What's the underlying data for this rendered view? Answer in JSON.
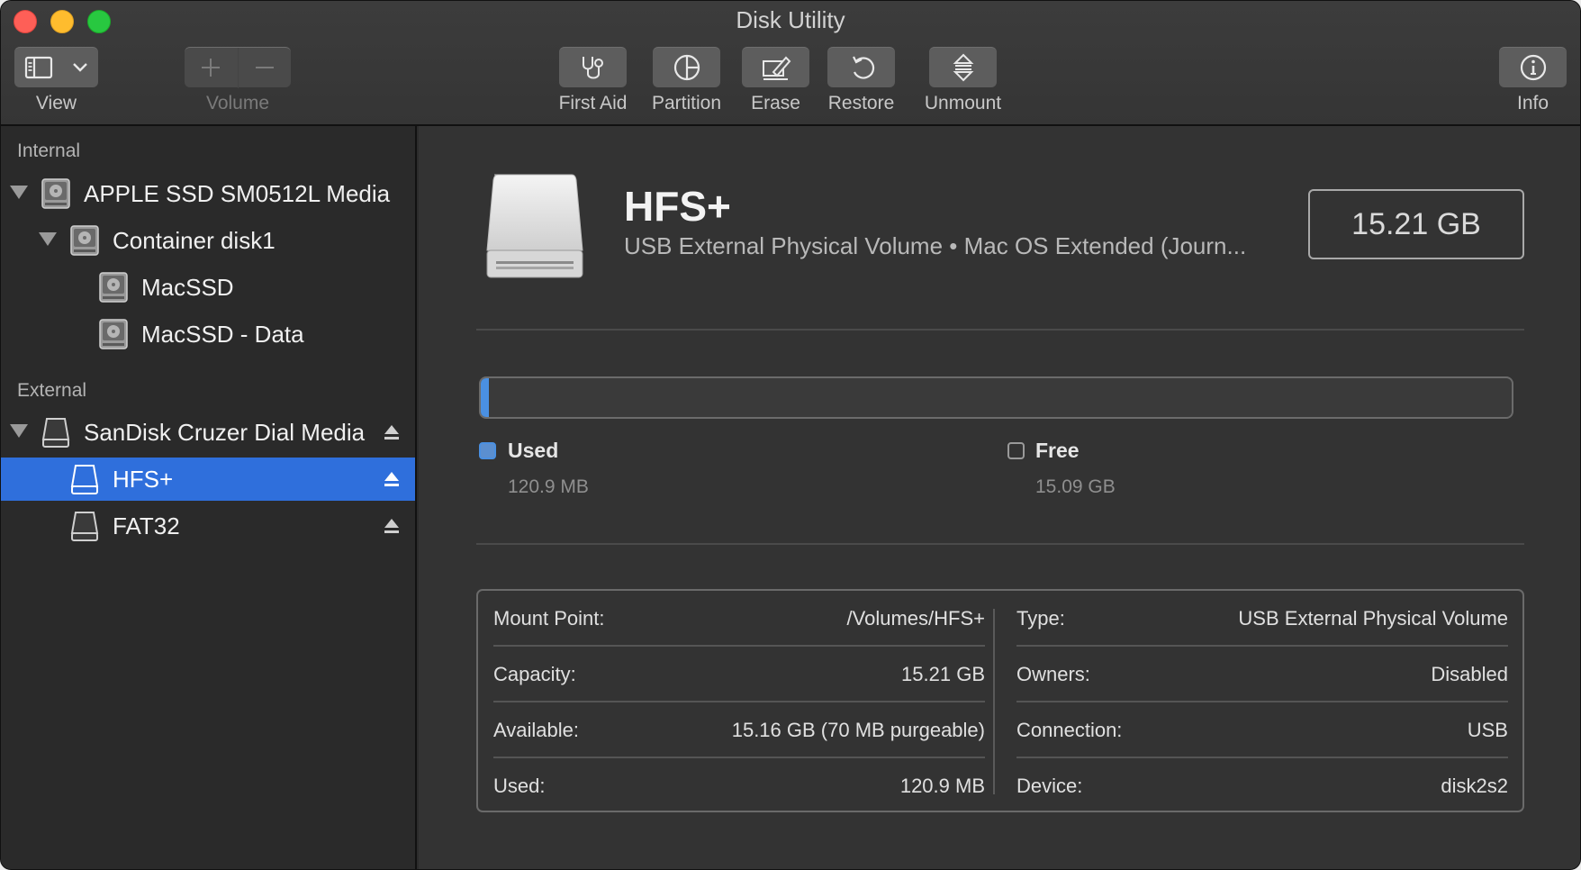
{
  "window": {
    "title": "Disk Utility"
  },
  "toolbar": {
    "view_label": "View",
    "volume_label": "Volume",
    "first_aid_label": "First Aid",
    "partition_label": "Partition",
    "erase_label": "Erase",
    "restore_label": "Restore",
    "unmount_label": "Unmount",
    "info_label": "Info"
  },
  "sidebar": {
    "internal_header": "Internal",
    "external_header": "External",
    "items": [
      {
        "label": "APPLE SSD SM0512L Media",
        "icon": "internal-disk-icon",
        "level": 0,
        "expanded": true
      },
      {
        "label": "Container disk1",
        "icon": "internal-disk-icon",
        "level": 1,
        "expanded": true
      },
      {
        "label": "MacSSD",
        "icon": "internal-disk-icon",
        "level": 2
      },
      {
        "label": "MacSSD - Data",
        "icon": "internal-disk-icon",
        "level": 2
      },
      {
        "label": "SanDisk Cruzer Dial Media",
        "icon": "external-disk-icon",
        "level": 0,
        "expanded": true,
        "ejectable": true
      },
      {
        "label": "HFS+",
        "icon": "external-disk-icon",
        "level": 1,
        "selected": true,
        "ejectable": true
      },
      {
        "label": "FAT32",
        "icon": "external-disk-icon",
        "level": 1,
        "ejectable": true
      }
    ]
  },
  "volume": {
    "name": "HFS+",
    "subtitle": "USB External Physical Volume • Mac OS Extended (Journ...",
    "size": "15.21 GB",
    "used_fraction": 0.008,
    "legend": {
      "used_label": "Used",
      "used_value": "120.9 MB",
      "free_label": "Free",
      "free_value": "15.09 GB"
    },
    "colors": {
      "used": "#4a90e2",
      "selection": "#2f6fdc"
    }
  },
  "info": {
    "left": [
      {
        "key": "Mount Point:",
        "value": "/Volumes/HFS+"
      },
      {
        "key": "Capacity:",
        "value": "15.21 GB"
      },
      {
        "key": "Available:",
        "value": "15.16 GB (70 MB purgeable)"
      },
      {
        "key": "Used:",
        "value": "120.9 MB"
      }
    ],
    "right": [
      {
        "key": "Type:",
        "value": "USB External Physical Volume"
      },
      {
        "key": "Owners:",
        "value": "Disabled"
      },
      {
        "key": "Connection:",
        "value": "USB"
      },
      {
        "key": "Device:",
        "value": "disk2s2"
      }
    ]
  }
}
